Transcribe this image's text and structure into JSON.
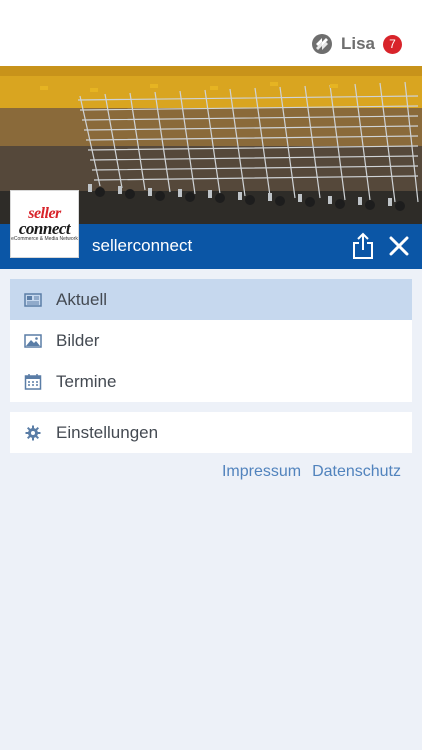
{
  "user": {
    "name": "Lisa",
    "notifications": "7"
  },
  "brand": {
    "name": "sellerconnect",
    "logo_line1": "seller",
    "logo_line2": "connect",
    "logo_line3": "eCommerce & Media Network"
  },
  "menu_main": [
    {
      "label": "Aktuell",
      "icon": "newspaper-icon",
      "active": true
    },
    {
      "label": "Bilder",
      "icon": "image-icon",
      "active": false
    },
    {
      "label": "Termine",
      "icon": "calendar-icon",
      "active": false
    }
  ],
  "menu_settings": [
    {
      "label": "Einstellungen",
      "icon": "gear-icon"
    }
  ],
  "footer_links": {
    "impressum": "Impressum",
    "datenschutz": "Datenschutz"
  },
  "colors": {
    "brand_blue": "#0b56a6",
    "active_row": "#c6d8ee",
    "badge": "#d8232a",
    "link": "#5183bd",
    "background": "#edf1f8"
  }
}
